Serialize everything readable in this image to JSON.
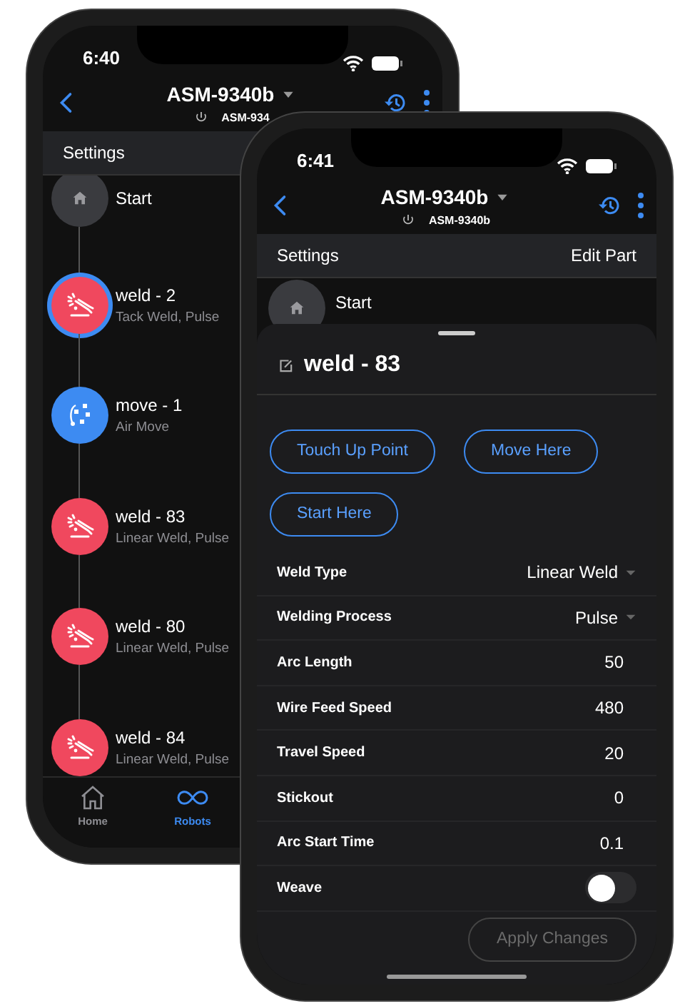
{
  "back_phone": {
    "status_time": "6:40",
    "header": {
      "title": "ASM-9340b",
      "subtitle": "ASM-934"
    },
    "bar": {
      "left": "Settings"
    },
    "steps": [
      {
        "kind": "start",
        "title": "Start",
        "selected": false
      },
      {
        "kind": "weld",
        "title": "weld - 2",
        "detail": "Tack Weld, Pulse",
        "selected": true
      },
      {
        "kind": "move",
        "title": "move - 1",
        "detail": "Air Move",
        "selected": false
      },
      {
        "kind": "weld",
        "title": "weld - 83",
        "detail": "Linear Weld, Pulse",
        "selected": false
      },
      {
        "kind": "weld",
        "title": "weld - 80",
        "detail": "Linear Weld, Pulse",
        "selected": false
      },
      {
        "kind": "weld",
        "title": "weld - 84",
        "detail": "Linear Weld, Pulse",
        "selected": false
      }
    ],
    "tabs": [
      {
        "kind": "home",
        "label": "Home",
        "selected": false
      },
      {
        "kind": "robots",
        "label": "Robots",
        "selected": true
      }
    ]
  },
  "front_phone": {
    "status_time": "6:41",
    "header": {
      "title": "ASM-9340b",
      "subtitle": "ASM-9340b"
    },
    "bar": {
      "left": "Settings",
      "right": "Edit Part"
    },
    "start_step": {
      "title": "Start"
    },
    "sheet": {
      "title": "weld - 83",
      "actions": [
        "Touch Up Point",
        "Move Here",
        "Start Here"
      ],
      "fields": [
        {
          "kind": "dropdown",
          "label": "Weld Type",
          "value": "Linear Weld"
        },
        {
          "kind": "dropdown",
          "label": "Welding Process",
          "value": "Pulse"
        },
        {
          "kind": "value",
          "label": "Arc Length",
          "value": "50"
        },
        {
          "kind": "value",
          "label": "Wire Feed Speed",
          "value": "480"
        },
        {
          "kind": "value",
          "label": "Travel Speed",
          "value": "20"
        },
        {
          "kind": "value",
          "label": "Stickout",
          "value": "0"
        },
        {
          "kind": "value",
          "label": "Arc Start Time",
          "value": "0.1"
        },
        {
          "kind": "toggle",
          "label": "Weave",
          "on": false
        }
      ],
      "apply_button": {
        "label": "Apply Changes",
        "disabled": true
      }
    }
  }
}
